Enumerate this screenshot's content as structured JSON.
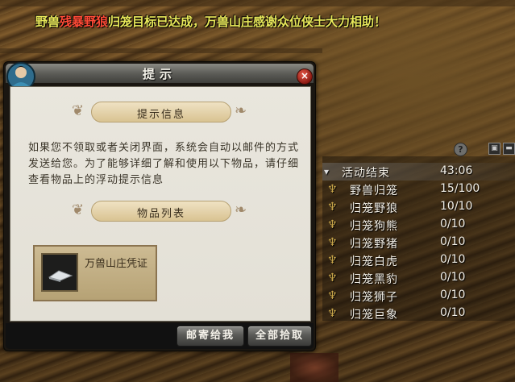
{
  "system_message": {
    "part1": "野兽",
    "highlight": "残暴野狼",
    "part2": "归笼目标已达成，万兽山庄感谢众位侠士大力相助！",
    "colors": {
      "normal": "#e8e85a",
      "highlight": "#ff4a36"
    }
  },
  "dialog": {
    "title": "提示",
    "close_label": "×",
    "info_header": "提示信息",
    "info_text": "如果您不领取或者关闭界面，系统会自动以邮件的方式发送给您。为了能够详细了解和使用以下物品，请仔细查看物品上的浮动提示信息",
    "items_header": "物品列表",
    "item": {
      "name": "万兽山庄凭证",
      "icon": "token-icon"
    },
    "buttons": {
      "mail": "邮寄给我",
      "take_all": "全部拾取"
    }
  },
  "tracker": {
    "help_label": "?",
    "header": {
      "name": "活动结束",
      "value": "43:06"
    },
    "rows": [
      {
        "name": "野兽归笼",
        "value": "15/100"
      },
      {
        "name": "归笼野狼",
        "value": "10/10"
      },
      {
        "name": "归笼狗熊",
        "value": "0/10"
      },
      {
        "name": "归笼野猪",
        "value": "0/10"
      },
      {
        "name": "归笼白虎",
        "value": "0/10"
      },
      {
        "name": "归笼黑豹",
        "value": "0/10"
      },
      {
        "name": "归笼狮子",
        "value": "0/10"
      },
      {
        "name": "归笼巨象",
        "value": "0/10"
      }
    ]
  }
}
